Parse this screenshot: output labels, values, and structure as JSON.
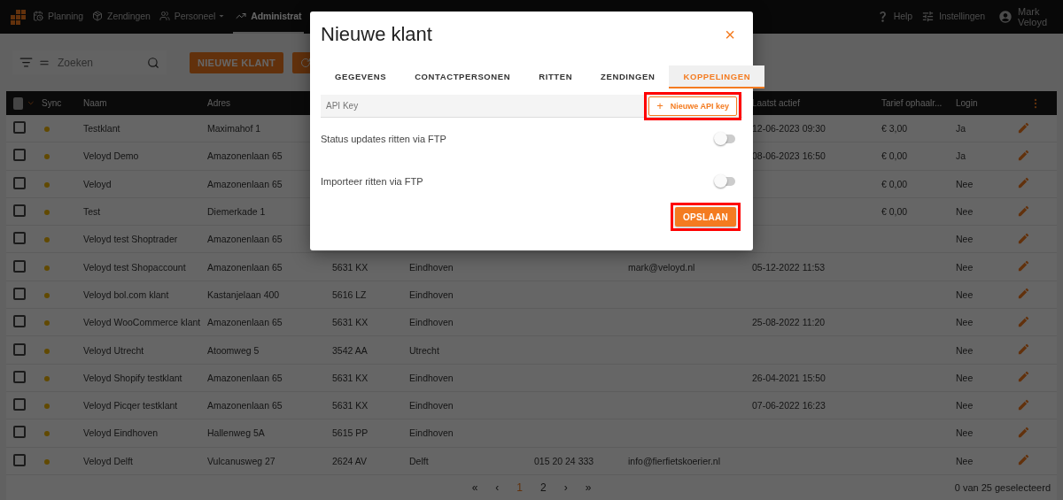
{
  "nav": {
    "items": [
      {
        "label": "Planning",
        "selected": false,
        "dropdown": false
      },
      {
        "label": "Zendingen",
        "selected": false,
        "dropdown": false
      },
      {
        "label": "Personeel",
        "selected": false,
        "dropdown": true
      },
      {
        "label": "Administrat",
        "selected": true,
        "dropdown": false
      }
    ],
    "right": [
      {
        "label": "Help"
      },
      {
        "label": "Instellingen"
      }
    ],
    "user": {
      "first": "Mark",
      "last": "Veloyd"
    }
  },
  "toolbar": {
    "search": {
      "placeholder": "Zoeken"
    },
    "new_button": "NIEUWE KLANT"
  },
  "table": {
    "all_selected": false,
    "columns": [
      "Sync",
      "Naam",
      "Adres",
      "Laatst actief",
      "Tarief ophaalr...",
      "Login"
    ],
    "rows": [
      {
        "name": "Testklant",
        "address": "Maximahof 1",
        "last_active": "12-06-2023 09:30",
        "tariff": "€ 3,00",
        "login": "Ja",
        "checked": false
      },
      {
        "name": "Veloyd Demo",
        "address": "Amazonenlaan 65",
        "last_active": "08-06-2023 16:50",
        "tariff": "€ 0,00",
        "login": "Ja",
        "checked": false
      },
      {
        "name": "Veloyd",
        "address": "Amazonenlaan 65",
        "tariff": "€ 0,00",
        "login": "Nee",
        "checked": false
      },
      {
        "name": "Test",
        "address": "Diemerkade 1",
        "tariff": "€ 0,00",
        "login": "Nee",
        "checked": false
      },
      {
        "name": "Veloyd test Shoptrader",
        "address": "Amazonenlaan 65",
        "login": "Nee",
        "checked": false
      },
      {
        "name": "Veloyd test Shopaccount",
        "address": "Amazonenlaan 65",
        "postcode": "5631 KX",
        "city": "Eindhoven",
        "email": "mark@veloyd.nl",
        "last_active": "05-12-2022 11:53",
        "login": "Nee",
        "checked": false
      },
      {
        "name": "Veloyd bol.com klant",
        "address": "Kastanjelaan 400",
        "postcode": "5616 LZ",
        "city": "Eindhoven",
        "login": "Nee",
        "checked": false
      },
      {
        "name": "Veloyd WooCommerce klant",
        "address": "Amazonenlaan 65",
        "postcode": "5631 KX",
        "city": "Eindhoven",
        "last_active": "25-08-2022 11:20",
        "login": "Nee",
        "checked": false
      },
      {
        "name": "Veloyd Utrecht",
        "address": "Atoomweg 5",
        "postcode": "3542 AA",
        "city": "Utrecht",
        "login": "Nee",
        "checked": false
      },
      {
        "name": "Veloyd Shopify testklant",
        "address": "Amazonenlaan 65",
        "postcode": "5631 KX",
        "city": "Eindhoven",
        "last_active": "26-04-2021 15:50",
        "login": "Nee",
        "checked": false
      },
      {
        "name": "Veloyd Picqer testklant",
        "address": "Amazonenlaan 65",
        "postcode": "5631 KX",
        "city": "Eindhoven",
        "last_active": "07-06-2022 16:23",
        "login": "Nee",
        "checked": false
      },
      {
        "name": "Veloyd Eindhoven",
        "address": "Hallenweg 5A",
        "postcode": "5615 PP",
        "city": "Eindhoven",
        "login": "Nee",
        "checked": false
      },
      {
        "name": "Veloyd Delft",
        "address": "Vulcanusweg 27",
        "postcode": "2624 AV",
        "city": "Delft",
        "phone": "015 20 24 333",
        "email": "info@fierfietskoerier.nl",
        "login": "Nee",
        "checked": false
      }
    ]
  },
  "pagination": {
    "items": [
      {
        "label": "«",
        "selected": false
      },
      {
        "label": "‹",
        "selected": false
      },
      {
        "label": "1",
        "selected": true
      },
      {
        "label": "2",
        "selected": false
      },
      {
        "label": "›",
        "selected": false
      },
      {
        "label": "»",
        "selected": false
      }
    ],
    "status": "0 van 25 geselecteerd"
  },
  "modal": {
    "title": "Nieuwe klant",
    "close": "×",
    "tabs": [
      {
        "label": "GEGEVENS",
        "selected": false
      },
      {
        "label": "CONTACTPERSONEN",
        "selected": false
      },
      {
        "label": "RITTEN",
        "selected": false
      },
      {
        "label": "ZENDINGEN",
        "selected": false
      },
      {
        "label": "KOPPELINGEN",
        "selected": true
      }
    ],
    "api_key": {
      "placeholder": "API Key"
    },
    "new_key_button": {
      "icon": "+",
      "label": "Nieuwe API key",
      "highlighted": true
    },
    "toggles": [
      {
        "label": "Status updates ritten via FTP",
        "on": false
      },
      {
        "label": "Importeer ritten via FTP",
        "on": false
      }
    ],
    "save_button": {
      "label": "OPSLAAN",
      "highlighted": true
    }
  }
}
